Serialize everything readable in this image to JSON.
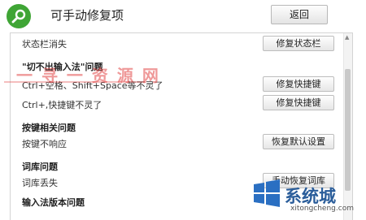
{
  "header": {
    "title": "可手动修复项",
    "back_label": "返回"
  },
  "items": {
    "status_bar": {
      "desc": "状态栏消失",
      "button": "修复状态栏"
    },
    "group1": {
      "title": "\"切不出输入法\"问题",
      "rows": [
        {
          "desc": "Ctrl+空格、Shift+Space等不灵了",
          "button": "修复快捷键"
        },
        {
          "desc": "Ctrl+,快捷键不灵了",
          "button": "修复快捷键"
        }
      ]
    },
    "group2": {
      "title": "按键相关问题",
      "rows": [
        {
          "desc": "按键不响应",
          "button": "恢复默认设置"
        }
      ]
    },
    "group3": {
      "title": "词库问题",
      "rows": [
        {
          "desc": "词库丢失",
          "button": "手动恢复词库"
        }
      ]
    },
    "group4": {
      "title": "输入法版本问题"
    }
  },
  "watermarks": {
    "top": "一 寻 一 资 源 网",
    "brand": "系统城",
    "url": "xitongcheng.com"
  },
  "colors": {
    "logo_green": "#3fa535",
    "brand_blue": "#2a5d9a"
  },
  "icons": {
    "logo": "wrench-icon",
    "watermark_logo": "windows-logo-icon"
  }
}
